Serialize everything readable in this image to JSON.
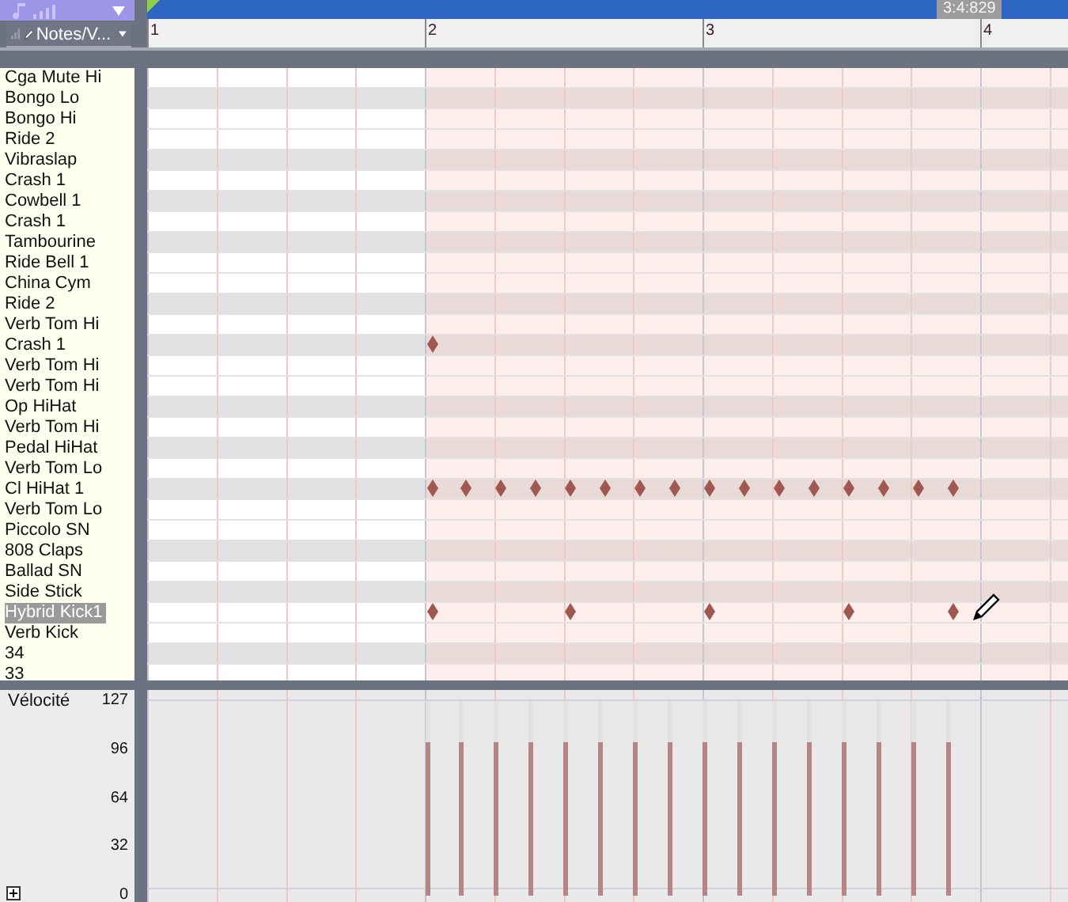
{
  "header": {
    "view_menu": "Notes/V...",
    "time_display": "3:4:829"
  },
  "ruler": {
    "measures": [
      "1",
      "2",
      "3",
      "4"
    ]
  },
  "drum_map": [
    {
      "name": "Cga Mute Hi",
      "shaded": false,
      "selected": false
    },
    {
      "name": "Bongo Lo",
      "shaded": true,
      "selected": false
    },
    {
      "name": "Bongo Hi",
      "shaded": false,
      "selected": false
    },
    {
      "name": "Ride 2",
      "shaded": false,
      "selected": false
    },
    {
      "name": "Vibraslap",
      "shaded": true,
      "selected": false
    },
    {
      "name": "Crash 1",
      "shaded": false,
      "selected": false
    },
    {
      "name": "Cowbell 1",
      "shaded": true,
      "selected": false
    },
    {
      "name": "Crash 1",
      "shaded": false,
      "selected": false
    },
    {
      "name": "Tambourine",
      "shaded": true,
      "selected": false
    },
    {
      "name": "Ride Bell 1",
      "shaded": false,
      "selected": false
    },
    {
      "name": "China Cym",
      "shaded": false,
      "selected": false
    },
    {
      "name": "Ride 2",
      "shaded": true,
      "selected": false
    },
    {
      "name": "Verb Tom Hi",
      "shaded": false,
      "selected": false
    },
    {
      "name": "Crash 1",
      "shaded": true,
      "selected": false,
      "hits": [
        false,
        false,
        false,
        false,
        false,
        false,
        false,
        false,
        true,
        false,
        false,
        false,
        false,
        false,
        false,
        false,
        false,
        false,
        false,
        false,
        false,
        false,
        false,
        false,
        false,
        false,
        false
      ]
    },
    {
      "name": "Verb Tom Hi",
      "shaded": false,
      "selected": false
    },
    {
      "name": "Verb Tom Hi",
      "shaded": false,
      "selected": false
    },
    {
      "name": "Op HiHat",
      "shaded": true,
      "selected": false
    },
    {
      "name": "Verb Tom Hi",
      "shaded": false,
      "selected": false
    },
    {
      "name": "Pedal HiHat",
      "shaded": true,
      "selected": false
    },
    {
      "name": "Verb Tom Lo",
      "shaded": false,
      "selected": false
    },
    {
      "name": "Cl HiHat 1",
      "shaded": true,
      "selected": false,
      "hits": [
        false,
        false,
        false,
        false,
        false,
        false,
        false,
        false,
        true,
        true,
        true,
        true,
        true,
        true,
        true,
        true,
        true,
        true,
        true,
        true,
        true,
        true,
        true,
        true,
        false,
        false,
        false
      ]
    },
    {
      "name": "Verb Tom Lo",
      "shaded": false,
      "selected": false
    },
    {
      "name": "Piccolo SN",
      "shaded": false,
      "selected": false
    },
    {
      "name": "808 Claps",
      "shaded": true,
      "selected": false
    },
    {
      "name": "Ballad SN",
      "shaded": false,
      "selected": false
    },
    {
      "name": "Side Stick",
      "shaded": true,
      "selected": false
    },
    {
      "name": "Hybrid Kick1",
      "shaded": false,
      "selected": true,
      "hits": [
        false,
        false,
        false,
        false,
        false,
        false,
        false,
        false,
        true,
        false,
        false,
        false,
        true,
        false,
        false,
        false,
        true,
        false,
        false,
        false,
        true,
        false,
        false,
        true,
        false,
        false,
        false
      ]
    },
    {
      "name": "Verb Kick",
      "shaded": false,
      "selected": false
    },
    {
      "name": "34",
      "shaded": true,
      "selected": false
    },
    {
      "name": "33",
      "shaded": false,
      "selected": false
    }
  ],
  "velocity_lane": {
    "label": "Vélocité",
    "scale": [
      "127",
      "96",
      "64",
      "32",
      "0"
    ],
    "bars": [
      {
        "level": 0.79
      },
      {
        "level": 0.79
      },
      {
        "level": 0.79
      },
      {
        "level": 0.79
      },
      {
        "level": 0.79
      },
      {
        "level": 0.79
      },
      {
        "level": 0.79
      },
      {
        "level": 0.79
      },
      {
        "level": 0.79
      },
      {
        "level": 0.79
      },
      {
        "level": 0.79
      },
      {
        "level": 0.79
      },
      {
        "level": 0.79
      },
      {
        "level": 0.79
      },
      {
        "level": 0.79
      },
      {
        "level": 0.79
      }
    ]
  }
}
